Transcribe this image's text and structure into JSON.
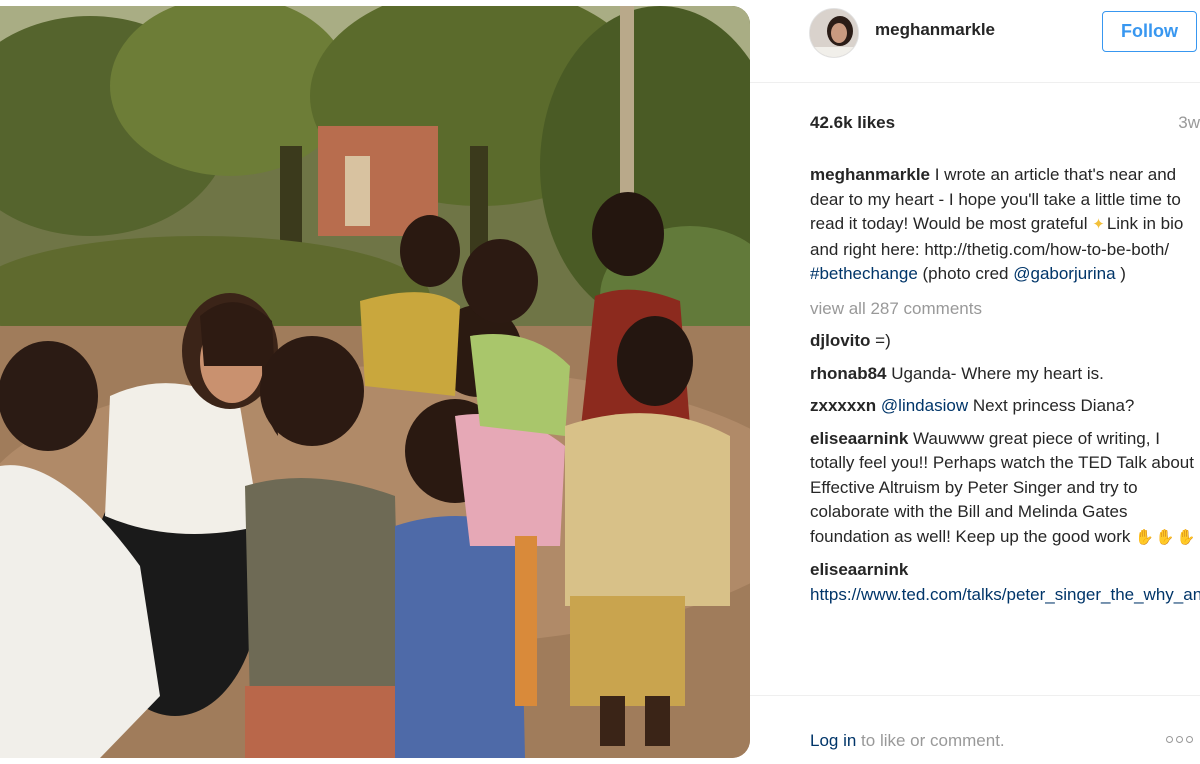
{
  "post": {
    "image_alt": "Woman crouching and smiling with a group of children outdoors among banana trees"
  },
  "header": {
    "username": "meghanmarkle",
    "follow_label": "Follow"
  },
  "stats": {
    "likes": "42.6k likes",
    "time_ago": "3w"
  },
  "caption": {
    "user": "meghanmarkle",
    "text_before_emoji": " I wrote an article that's near and dear to my heart - I hope you'll take a little time to read it today! Would be most grateful ",
    "text_after_emoji": "Link in bio and right here: http://thetig.com/how-to-be-both/ ",
    "hashtag": "#bethechange",
    "text_mid": " (photo cred ",
    "mention": "@gaborjurina",
    "text_end": " )"
  },
  "view_all_comments": "view all 287 comments",
  "comments": [
    {
      "user": "djlovito",
      "text": " =)"
    },
    {
      "user": "rhonab84",
      "text": " Uganda- Where my heart is."
    },
    {
      "user": "zxxxxxn",
      "mention": "@lindasiow",
      "text": " Next princess Diana?"
    },
    {
      "user": "eliseaarnink",
      "text": " Wauwww great piece of writing, I totally feel you!! Perhaps watch the TED Talk about Effective Altruism by Peter Singer and try to colaborate with the Bill and Melinda Gates foundation as well! Keep up the good work "
    },
    {
      "user": "eliseaarnink",
      "text": " https://www.ted.com/talks/peter_singer_the_why_and_how_of_effective_altruism"
    }
  ],
  "footer": {
    "login_link": "Log in",
    "login_rest": " to like or comment."
  },
  "icons": {
    "more": "more-options-icon",
    "emoji_sparkle": "sparkle-emoji-icon",
    "emoji_hands": "clapping-hands-icon"
  },
  "colors": {
    "link": "#003569",
    "follow": "#3897f0",
    "muted": "#999999"
  }
}
